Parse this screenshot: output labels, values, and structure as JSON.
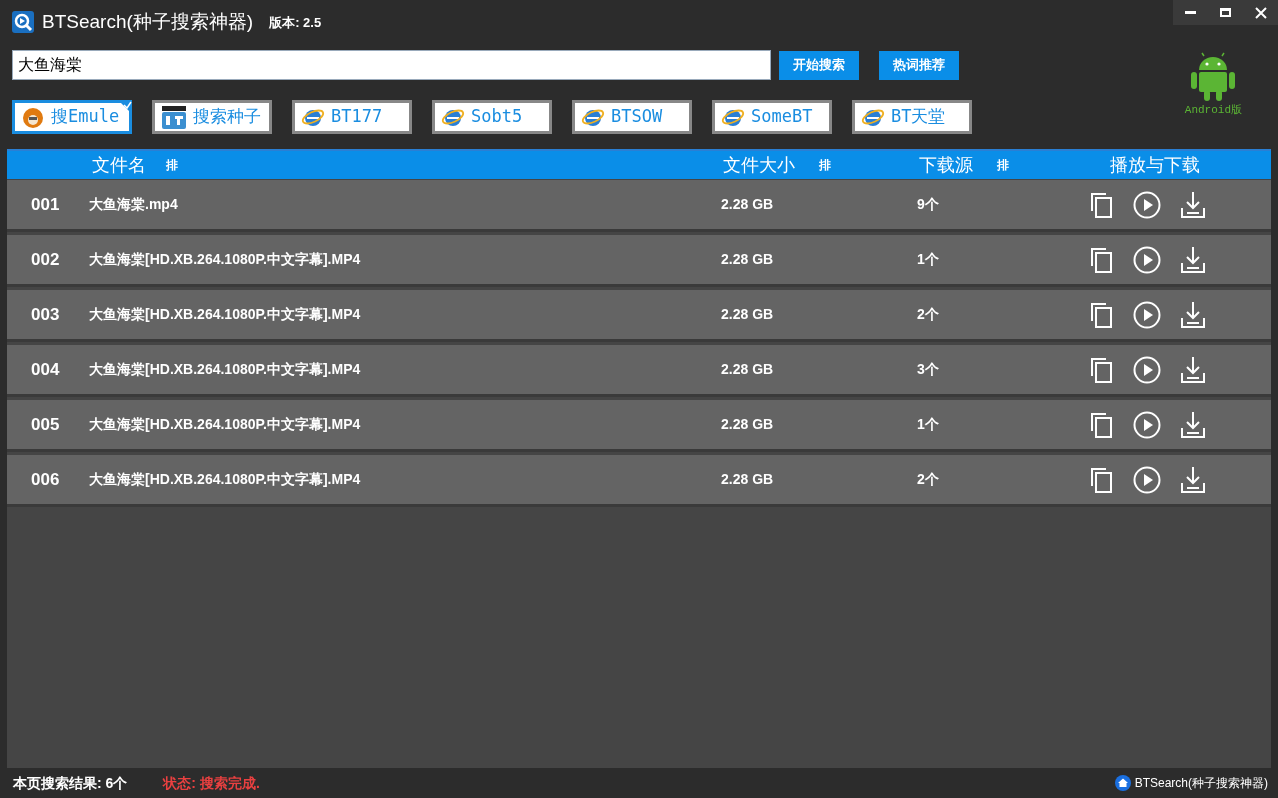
{
  "window": {
    "title": "BTSearch(种子搜索神器)",
    "version": "版本: 2.5"
  },
  "search": {
    "value": "大鱼海棠",
    "buttons": [
      "开始搜索",
      "热词推荐"
    ]
  },
  "android": {
    "label": "Android版"
  },
  "engines": [
    {
      "label": "搜Emule",
      "kind": "emule",
      "selected": true
    },
    {
      "label": "搜索种子",
      "kind": "bt",
      "selected": false
    },
    {
      "label": "BT177",
      "kind": "ie",
      "selected": false
    },
    {
      "label": "Sobt5",
      "kind": "ie",
      "selected": false
    },
    {
      "label": "BTSOW",
      "kind": "ie",
      "selected": false
    },
    {
      "label": "SomeBT",
      "kind": "ie",
      "selected": false
    },
    {
      "label": "BT天堂",
      "kind": "ie",
      "selected": false
    }
  ],
  "table": {
    "columns": [
      {
        "label": "文件名",
        "sort": "排"
      },
      {
        "label": "文件大小",
        "sort": "排"
      },
      {
        "label": "下载源",
        "sort": "排"
      },
      {
        "label": "播放与下载"
      }
    ],
    "rows": [
      {
        "index": "001",
        "name": "大鱼海棠.mp4",
        "size": "2.28 GB",
        "sources": "9个"
      },
      {
        "index": "002",
        "name": "大鱼海棠[HD.XB.264.1080P.中文字幕].MP4",
        "size": "2.28 GB",
        "sources": "1个"
      },
      {
        "index": "003",
        "name": "大鱼海棠[HD.XB.264.1080P.中文字幕].MP4",
        "size": "2.28 GB",
        "sources": "2个"
      },
      {
        "index": "004",
        "name": "大鱼海棠[HD.XB.264.1080P.中文字幕].MP4",
        "size": "2.28 GB",
        "sources": "3个"
      },
      {
        "index": "005",
        "name": "大鱼海棠[HD.XB.264.1080P.中文字幕].MP4",
        "size": "2.28 GB",
        "sources": "1个"
      },
      {
        "index": "006",
        "name": "大鱼海棠[HD.XB.264.1080P.中文字幕].MP4",
        "size": "2.28 GB",
        "sources": "2个"
      }
    ]
  },
  "status_bar": {
    "results": "本页搜索结果: 6个",
    "status": "状态: 搜索完成.",
    "app": "BTSearch(种子搜索神器)"
  }
}
